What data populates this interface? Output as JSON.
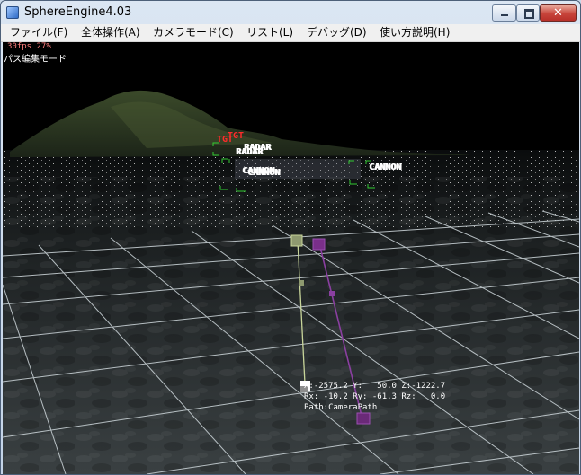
{
  "window": {
    "title": "SphereEngine4.03"
  },
  "menu": {
    "items": [
      {
        "label": "ファイル(F)"
      },
      {
        "label": "全体操作(A)"
      },
      {
        "label": "カメラモード(C)"
      },
      {
        "label": "リスト(L)"
      },
      {
        "label": "デバッグ(D)"
      },
      {
        "label": "使い方説明(H)"
      }
    ]
  },
  "viewport": {
    "fps": "30fps  27%",
    "mode": "パス編集モード",
    "labels": {
      "tgt1": "TGT",
      "tgt2": "TGT",
      "radar1": "RADAR",
      "radar2": "RADAR",
      "cannon1": "CANNON",
      "cannon2": "CANNON",
      "cannon3": "CANNON"
    },
    "coords": {
      "line1": "X:-2575.2 Y:   50.0 Z:-1222.7",
      "line2": "Rx: -10.2 Ry: -61.3 Rz:   0.0",
      "line3": "Path:CameraPath"
    }
  },
  "colors": {
    "tgt": "#ff2b2b",
    "path_light": "#c8d59a",
    "path_purple": "#8a3fa0",
    "marker_green": "#33cc33"
  }
}
